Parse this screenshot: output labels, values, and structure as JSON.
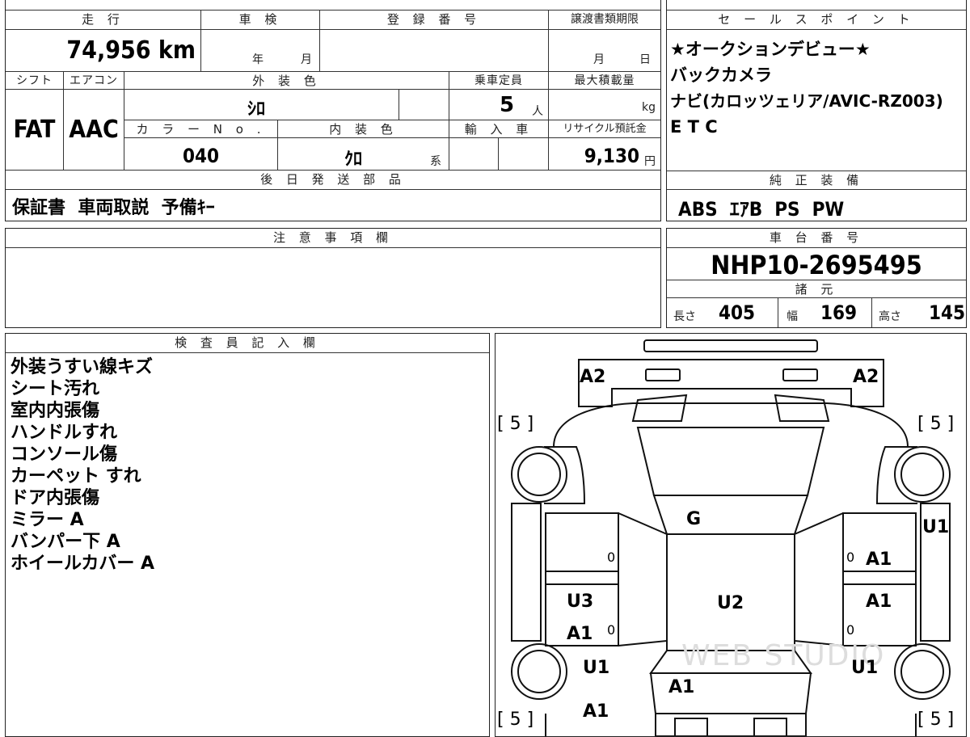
{
  "top_header": {
    "mileage_label": "走 行",
    "inspection_label": "車 検",
    "registration_label": "登 録 番 号",
    "transfer_deadline_label": "譲渡書類期限",
    "mileage_value": "74,956 km",
    "inspection_year_unit": "年",
    "inspection_month_unit": "月",
    "deadline_month_unit": "月",
    "deadline_day_unit": "日"
  },
  "sales_points": {
    "label": "セ ー ル ス ポ イ ン ト",
    "lines": [
      "★オークションデビュー★",
      "バックカメラ",
      "ナビ(カロッツェリア/AVIC-RZ003)",
      "E T C"
    ]
  },
  "row2": {
    "shift_label": "シフト",
    "ac_label": "エアコン",
    "exterior_color_label": "外 装 色",
    "capacity_label": "乗車定員",
    "max_load_label": "最大積載量",
    "shift_value": "FAT",
    "ac_value": "AAC",
    "exterior_color_value": "ｼﾛ",
    "capacity_value": "5",
    "capacity_unit": "人",
    "max_load_unit": "kg",
    "color_no_label": "カ ラ ー N o .",
    "interior_color_label": "内 装 色",
    "import_label": "輸 入 車",
    "recycle_label": "リサイクル預託金",
    "color_no_value": "040",
    "interior_color_value": "ｸﾛ",
    "interior_color_unit": "系",
    "recycle_value": "9,130",
    "recycle_unit": "円"
  },
  "later_parts": {
    "label": "後 日 発 送 部 品",
    "value": "保証書  車両取説  予備ｷｰ"
  },
  "factory_equipment": {
    "label": "純 正 装 備",
    "value": "ABS  ｴｱB  PS  PW"
  },
  "notes": {
    "label": "注 意 事 項 欄"
  },
  "chassis": {
    "label": "車 台 番 号",
    "value": "NHP10-2695495",
    "specs_label": "諸 元",
    "length_label": "長さ",
    "length_value": "405",
    "width_label": "幅",
    "width_value": "169",
    "height_label": "高さ",
    "height_value": "145"
  },
  "inspector": {
    "label": "検 査 員 記 入 欄",
    "lines": [
      "外装うすい線キズ",
      "シート汚れ",
      "室内内張傷",
      "ハンドルすれ",
      "コンソール傷",
      "カーペット すれ",
      "ドア内張傷",
      "ミラー A",
      "バンパー下 A",
      "ホイールカバー A"
    ]
  },
  "diagram": {
    "marks": {
      "front_left": "A2",
      "front_right": "A2",
      "tire_fl": "[ 5 ]",
      "tire_fr": "[ 5 ]",
      "tire_rl": "[ 5 ]",
      "tire_rr": "[ 5 ]",
      "hood": "G",
      "right_fender": "U1",
      "right_front_door": "A1",
      "right_rear_door": "A1",
      "right_rear_fender": "U1",
      "left_rear_door_top": "U3",
      "left_rear_door_bottom": "A1",
      "roof": "U2",
      "left_rear_fender": "U1",
      "rear_left": "A1",
      "trunk": "A1",
      "zero": "0"
    },
    "watermark": "WEB STUDIO"
  }
}
